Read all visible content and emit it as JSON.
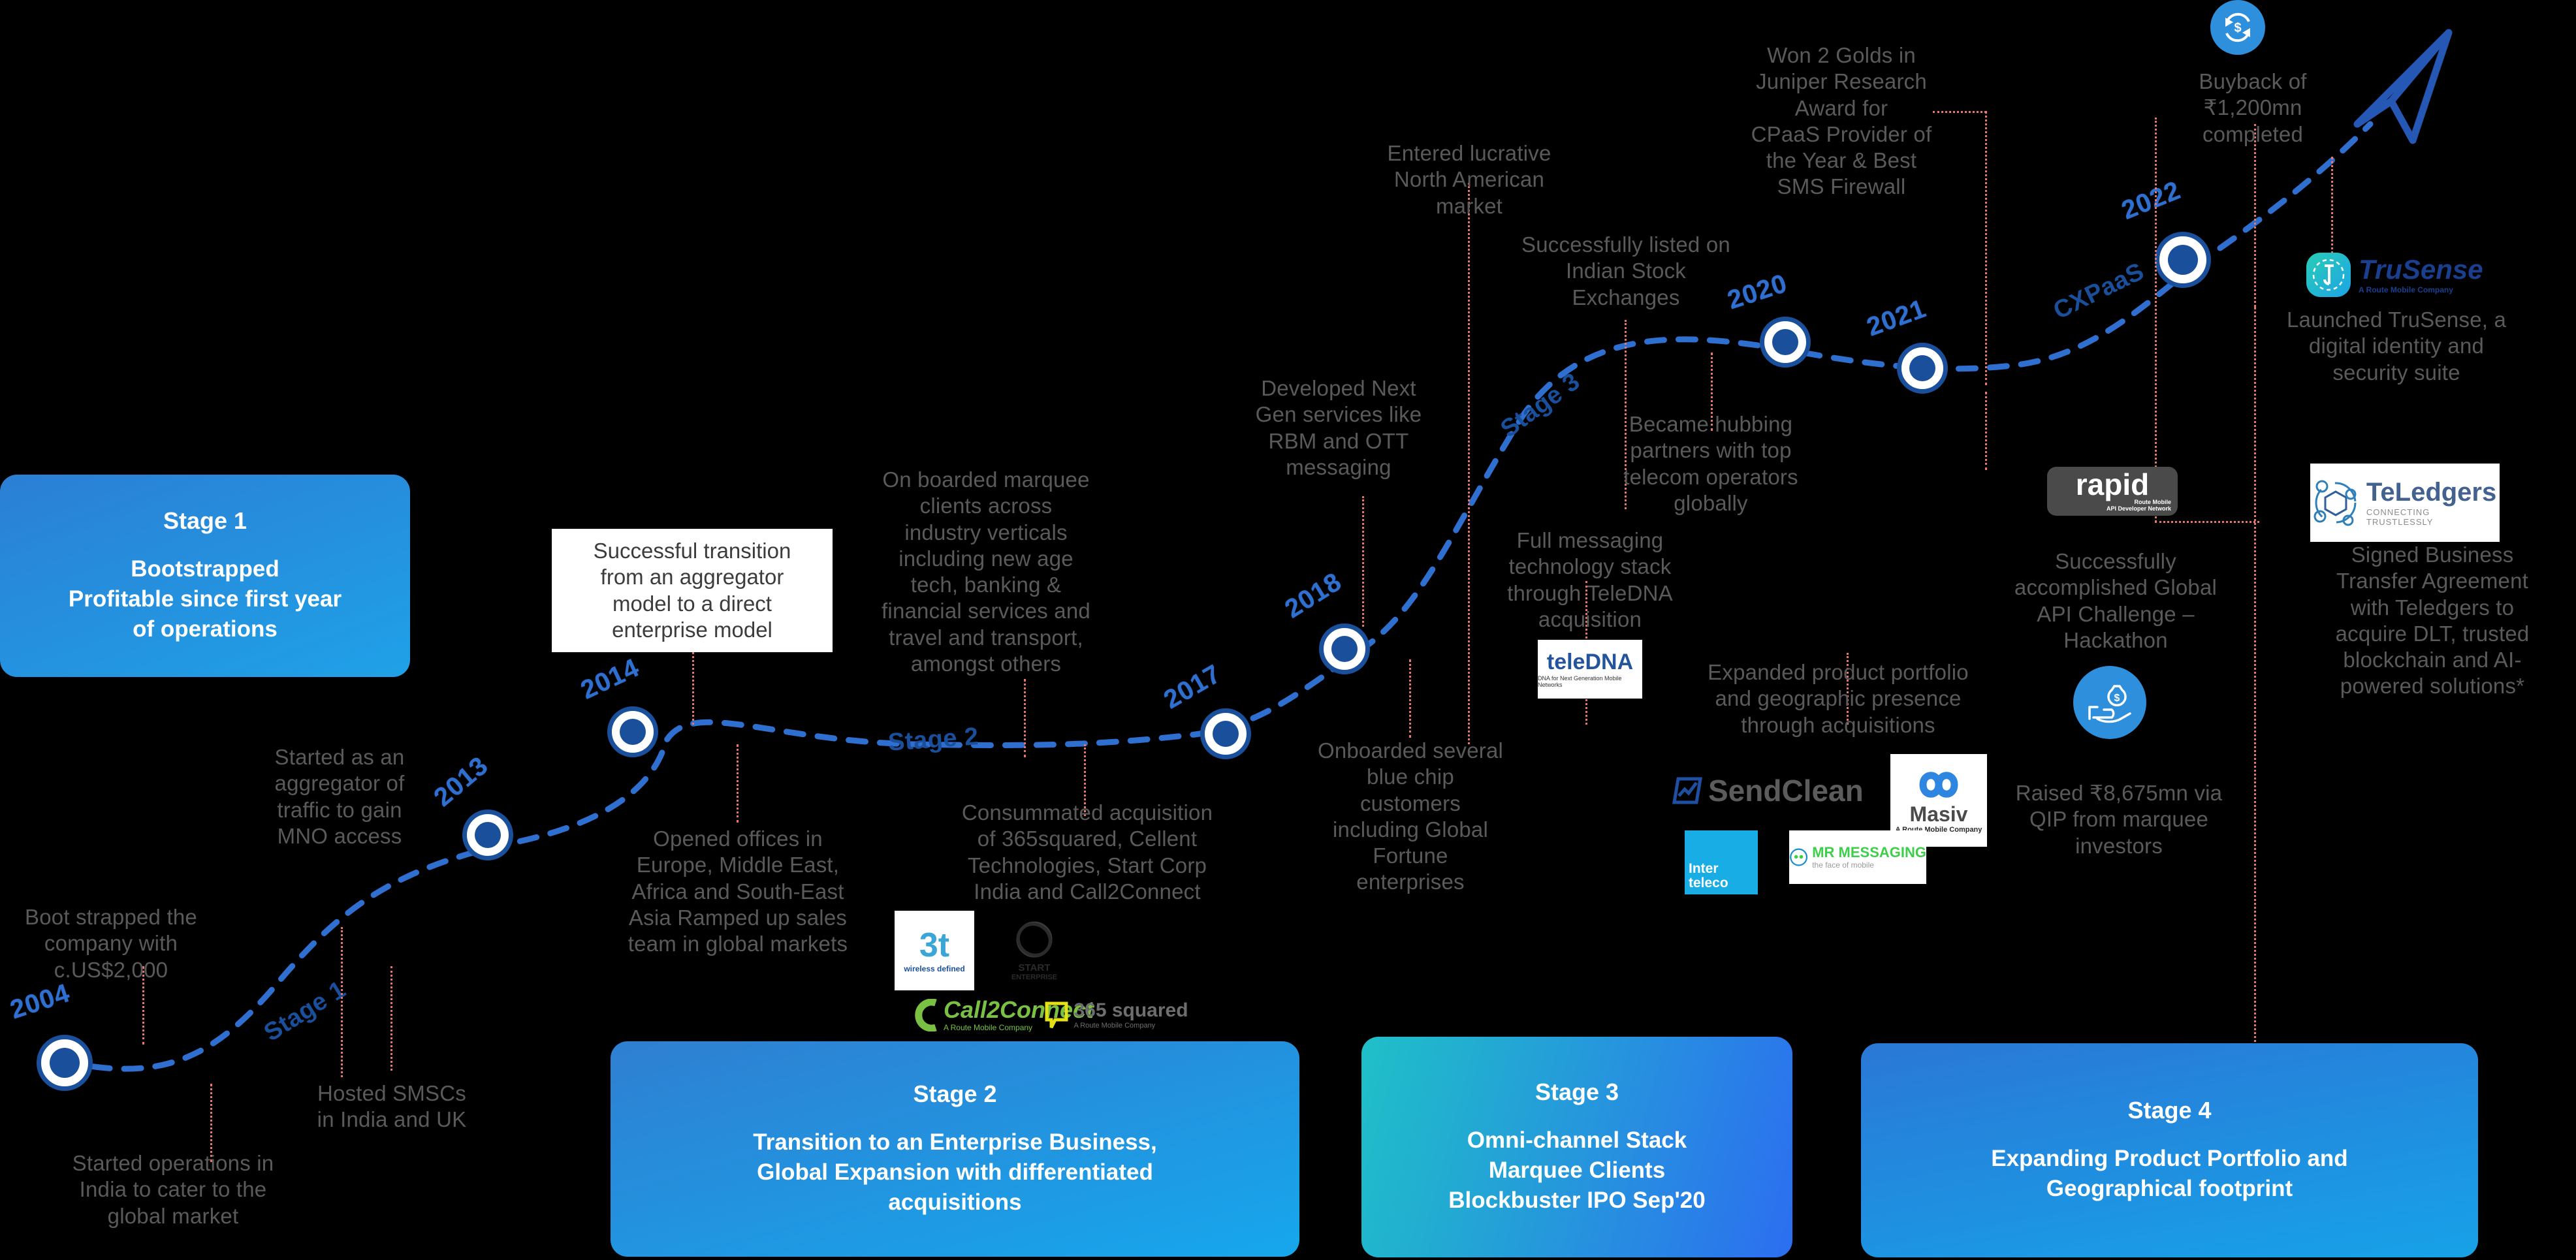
{
  "theme": {
    "background": "#000000",
    "marker_blue": "#1a4f9c",
    "year_blue": "#2f6fd0",
    "note_gray": "#5a5a5a",
    "leader_salmon": "#e8766a",
    "banner_blue_start": "#2b7fd4",
    "banner_blue_end": "#1fa1e8",
    "stage3_teal": "#1fc0c8",
    "stage3_blue": "#2c6ef0"
  },
  "banners": [
    {
      "id": "stage-1",
      "title": "Stage 1",
      "subtitle": "Bootstrapped\nProfitable since first year\nof operations"
    },
    {
      "id": "stage-2",
      "title": "Stage 2",
      "subtitle": "Transition to an Enterprise Business,\nGlobal Expansion with differentiated\nacquisitions"
    },
    {
      "id": "stage-3",
      "title": "Stage 3",
      "subtitle": "Omni-channel Stack\nMarquee Clients\nBlockbuster IPO Sep'20"
    },
    {
      "id": "stage-4",
      "title": "Stage 4",
      "subtitle": "Expanding Product Portfolio and\nGeographical footprint"
    }
  ],
  "path_labels": [
    {
      "id": "stage-1-path",
      "text": "Stage 1"
    },
    {
      "id": "stage-2-path",
      "text": "Stage 2"
    },
    {
      "id": "stage-3-path",
      "text": "Stage 3"
    },
    {
      "id": "cxpaas-path",
      "text": "CXPaaS"
    }
  ],
  "years": [
    {
      "id": "y2004",
      "label": "2004"
    },
    {
      "id": "y2013",
      "label": "2013"
    },
    {
      "id": "y2014",
      "label": "2014"
    },
    {
      "id": "y2017",
      "label": "2017"
    },
    {
      "id": "y2018",
      "label": "2018"
    },
    {
      "id": "y2020",
      "label": "2020"
    },
    {
      "id": "y2021",
      "label": "2021"
    },
    {
      "id": "y2022",
      "label": "2022"
    }
  ],
  "notes": {
    "bootstrapped": "Boot strapped the\ncompany with\nc.US$2,000",
    "started_ops_india": "Started operations in\nIndia to cater to the\nglobal market",
    "aggregator": "Started as an\naggregator of\ntraffic to gain\nMNO access",
    "hosted_smscs": "Hosted SMSCs\nin India and UK",
    "opened_offices": "Opened offices in\nEurope, Middle East,\nAfrica and South-East\nAsia Ramped up sales\nteam in global markets",
    "successful_transition": "Successful transition\nfrom an aggregator\nmodel to a direct\nenterprise model",
    "onboarded_marquee": "On boarded marquee\nclients across\nindustry verticals\nincluding new age\ntech, banking &\nfinancial services and\ntravel and transport,\namongst others",
    "consummated_acq": "Consummated acquisition\nof 365squared, Cellent\nTechnologies, Start Corp\nIndia and Call2Connect",
    "developed_nextgen": "Developed Next\nGen services like\nRBM and OTT\nmessaging",
    "onboarded_bluechip": "Onboarded several\nblue chip\ncustomers\nincluding Global\nFortune\nenterprises",
    "entered_na": "Entered lucrative\nNorth American\nmarket",
    "listed_exchanges": "Successfully listed on\nIndian Stock\nExchanges",
    "full_stack_teledna": "Full messaging\ntechnology stack\nthrough TeleDNA\nacquisition",
    "hubbing_partners": "Became hubbing\npartners with top\ntelecom operators\nglobally",
    "won_golds": "Won 2 Golds in\nJuniper Research\nAward for\nCPaaS Provider of\nthe Year & Best\nSMS Firewall",
    "expanded_portfolio": "Expanded product portfolio\nand geographic presence\nthrough acquisitions",
    "global_api_challenge": "Successfully\naccomplished Global\nAPI Challenge –\nHackathon",
    "qip_raise": "Raised ₹8,675mn via\nQIP from marquee\ninvestors",
    "buyback": "Buyback of\n₹1,200mn\ncompleted",
    "trusense": "Launched TruSense, a\ndigital identity and\nsecurity suite",
    "teledgers": "Signed Business\nTransfer Agreement\nwith Teledgers to\nacquire DLT, trusted\nblockchain and AI-\npowered solutions*"
  },
  "logos": [
    {
      "id": "3t-wireless",
      "name": "3t",
      "tagline": "wireless defined"
    },
    {
      "id": "start-enterprise",
      "name": "START",
      "tagline": "ENTERPRISE"
    },
    {
      "id": "call2connect",
      "name": "Call2Connect",
      "tagline": "A Route Mobile Company"
    },
    {
      "id": "365squared",
      "name": "365 squared",
      "tagline": "A Route Mobile Company"
    },
    {
      "id": "teledna",
      "name": "teleDNA",
      "tagline": "DNA for Next Generation Mobile Networks"
    },
    {
      "id": "sendclean",
      "name": "SendClean",
      "tagline": ""
    },
    {
      "id": "masiv",
      "name": "Masiv",
      "tagline": "A Route Mobile Company"
    },
    {
      "id": "interteleco",
      "name": "Inter teleco",
      "tagline": ""
    },
    {
      "id": "mr-messaging",
      "name": "MR MESSAGING",
      "tagline": "the face of mobile"
    },
    {
      "id": "rapid",
      "name": "rapid",
      "tagline": "Route Mobile\nAPI Developer Network"
    },
    {
      "id": "trusense",
      "name": "TruSense",
      "tagline": "A Route Mobile Company"
    },
    {
      "id": "teledgers",
      "name": "TeLedgers",
      "tagline": "CONNECTING TRUSTLESSLY"
    }
  ],
  "icons": {
    "buyback": "buyback-money-icon",
    "qip": "hand-money-bag-icon",
    "arrow": "paper-plane-arrow-icon"
  }
}
